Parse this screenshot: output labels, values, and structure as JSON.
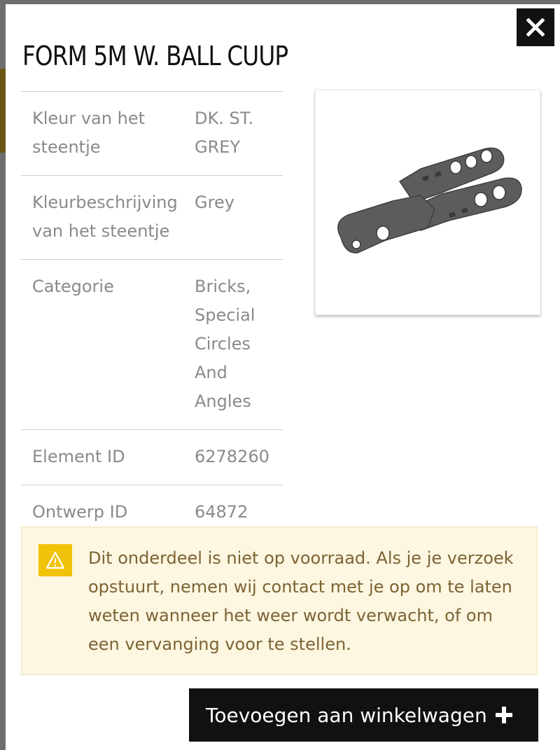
{
  "modal": {
    "title": "FORM 5M W. BALL CUUP",
    "close_icon": "close-icon"
  },
  "specs": [
    {
      "label": "Kleur van het steentje",
      "value": "DK. ST. GREY"
    },
    {
      "label": "Kleurbeschrijving van het steentje",
      "value": "Grey"
    },
    {
      "label": "Categorie",
      "value": "Bricks, Special Circles And Angles"
    },
    {
      "label": "Element ID",
      "value": "6278260"
    },
    {
      "label": "Ontwerp ID",
      "value": "64872"
    }
  ],
  "product_image": {
    "description_icon": "technic-part-image",
    "part_color": "#5c5c5c"
  },
  "notice": {
    "icon": "warning-icon",
    "text": "Dit onderdeel is niet op voorraad. Als je je verzoek opstuurt, nemen wij contact met je op om te laten weten wanneer het weer wordt verwacht, of om een vervanging voor te stellen.",
    "background": "#fdf6e0",
    "icon_background": "#f0c20a"
  },
  "add_button": {
    "label": "Toevoegen aan winkelwagen",
    "icon": "plus-icon"
  }
}
